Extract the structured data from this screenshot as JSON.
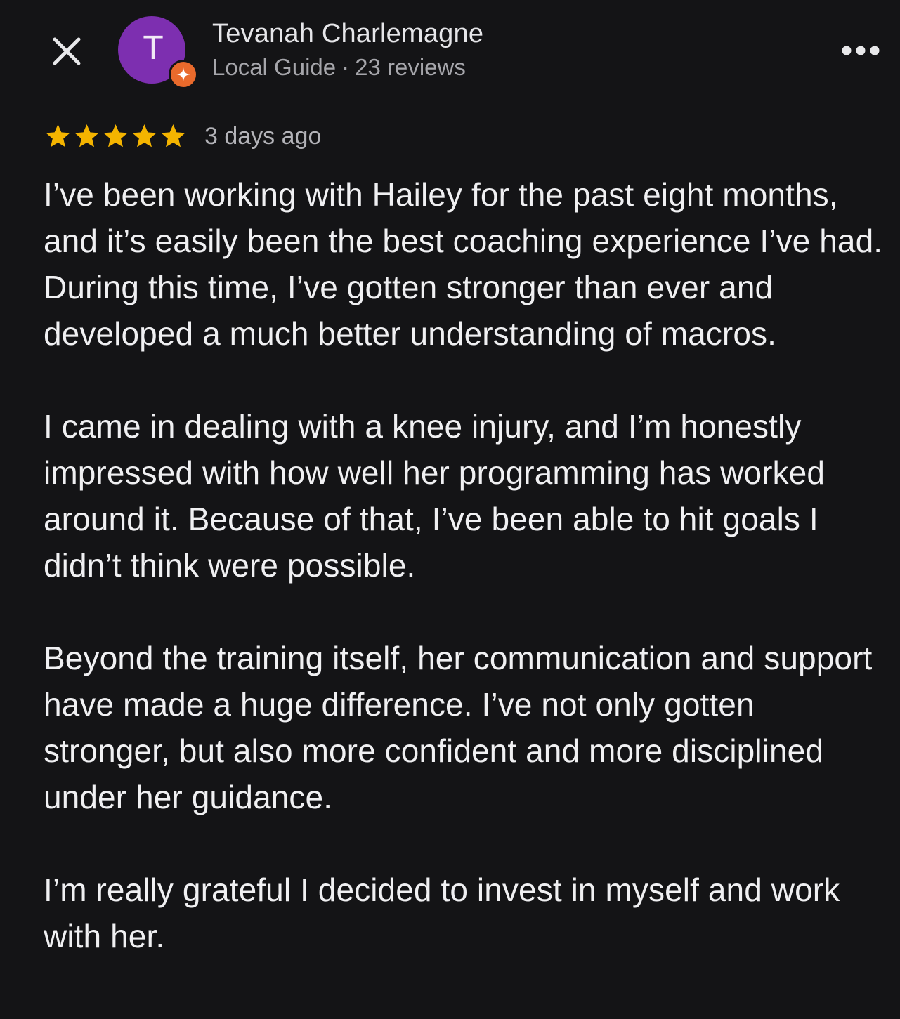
{
  "header": {
    "close_icon": "close-icon",
    "avatar_initial": "T",
    "avatar_color": "#7d2fb0",
    "badge_color": "#e96a2c",
    "badge_icon": "local-guide-star-icon",
    "name": "Tevanah Charlemagne",
    "role": "Local Guide",
    "separator": "·",
    "review_count": "23 reviews",
    "more_icon": "more-horizontal-icon"
  },
  "rating": {
    "stars": 5,
    "max_stars": 5,
    "star_color": "#f4b400",
    "date": "3 days ago"
  },
  "review": {
    "paragraphs": [
      "I’ve been working with Hailey for the past eight months, and it’s easily been the best coaching experience I’ve had. During this time, I’ve gotten stronger than ever and developed a much better understanding of macros.",
      "I came in dealing with a knee injury, and I’m honestly impressed with how well her programming has worked around it. Because of that, I’ve been able to hit goals I didn’t think were possible.",
      "Beyond the training itself, her communication and support have made a huge difference. I’ve not only gotten stronger, but also more confident and more disciplined under her guidance.",
      "I’m really grateful I decided to invest in myself and work with her."
    ]
  }
}
